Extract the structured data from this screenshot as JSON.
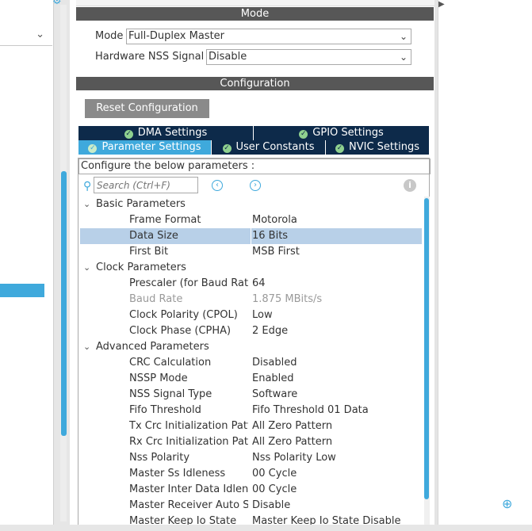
{
  "mode": {
    "header": "Mode",
    "mode_label": "Mode",
    "mode_value": "Full-Duplex Master",
    "nss_label": "Hardware NSS Signal",
    "nss_value": "Disable"
  },
  "configuration": {
    "header": "Configuration",
    "reset_button": "Reset Configuration",
    "tabs_row1": [
      {
        "label": "DMA Settings"
      },
      {
        "label": "GPIO Settings"
      }
    ],
    "tabs_row2": [
      {
        "label": "Parameter Settings",
        "active": true
      },
      {
        "label": "User Constants"
      },
      {
        "label": "NVIC Settings"
      }
    ],
    "describe_text": "Configure the below parameters :",
    "search_placeholder": "Search (Ctrl+F)",
    "groups": [
      {
        "label": "Basic Parameters",
        "params": [
          {
            "name": "Frame Format",
            "value": "Motorola"
          },
          {
            "name": "Data Size",
            "value": "16 Bits",
            "selected": true
          },
          {
            "name": "First Bit",
            "value": "MSB First"
          }
        ]
      },
      {
        "label": "Clock Parameters",
        "params": [
          {
            "name": "Prescaler (for Baud Rate)",
            "value": "64"
          },
          {
            "name": "Baud Rate",
            "value": "1.875 MBits/s",
            "disabled": true
          },
          {
            "name": "Clock Polarity (CPOL)",
            "value": "Low"
          },
          {
            "name": "Clock Phase (CPHA)",
            "value": "2 Edge"
          }
        ]
      },
      {
        "label": "Advanced Parameters",
        "params": [
          {
            "name": "CRC Calculation",
            "value": "Disabled"
          },
          {
            "name": "NSSP Mode",
            "value": "Enabled"
          },
          {
            "name": "NSS Signal Type",
            "value": "Software"
          },
          {
            "name": "Fifo Threshold",
            "value": "Fifo Threshold 01 Data"
          },
          {
            "name": "Tx Crc Initialization Pattern",
            "value": "All Zero Pattern"
          },
          {
            "name": "Rx Crc Initialization Pattern",
            "value": "All Zero Pattern"
          },
          {
            "name": "Nss Polarity",
            "value": "Nss Polarity Low"
          },
          {
            "name": "Master Ss Idleness",
            "value": "00 Cycle"
          },
          {
            "name": "Master Inter Data Idleness",
            "value": "00 Cycle"
          },
          {
            "name": "Master Receiver Auto Susp",
            "value": "Disable"
          },
          {
            "name": "Master Keep Io State",
            "value": "Master Keep Io State Disable"
          }
        ]
      }
    ]
  },
  "icons": {
    "search": "search-icon",
    "prev": "chevron-left-icon",
    "next": "chevron-right-icon",
    "info": "info-icon",
    "zoom": "zoom-in-icon",
    "check": "check-circle-icon"
  },
  "colors": {
    "accent": "#3fa9dc",
    "tab_dark": "#0d2a4a",
    "header_bg": "#575757",
    "selection": "#b8d0e8"
  }
}
